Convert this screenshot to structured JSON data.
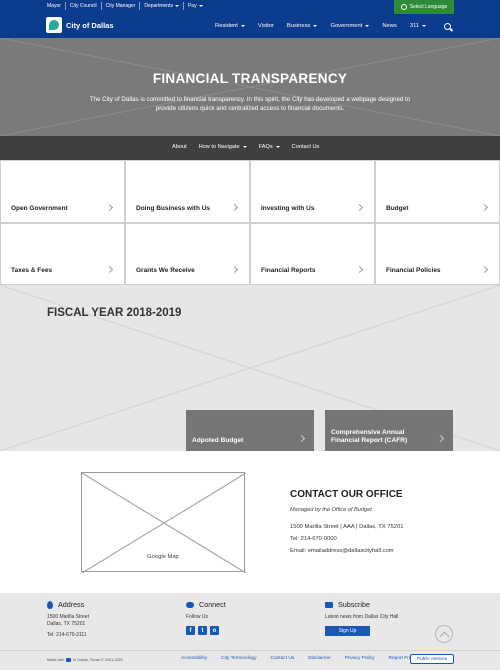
{
  "utility": {
    "links": [
      "Mayor",
      "City Council",
      "City Manager",
      "Departments",
      "Pay"
    ],
    "language_button": "Select Language"
  },
  "header": {
    "logo_text": "City of Dallas",
    "nav": [
      "Resident",
      "Visitor",
      "Business",
      "Government",
      "News",
      "311"
    ]
  },
  "hero": {
    "title": "FINANCIAL TRANSPARENCY",
    "description": "The City of Dallas is committed to financial transparency. In this spirit, the City has developed a webpage designed to provide citizens quick and centralized access to financial documents."
  },
  "subnav": {
    "items": [
      "About",
      "How to Navigate",
      "FAQs",
      "Contact Us"
    ]
  },
  "tiles": [
    "Open Government",
    "Doing Business with Us",
    "Investing with Us",
    "Budget",
    "Taxes & Fees",
    "Grants We Receive",
    "Financial Reports",
    "Financial Policies"
  ],
  "fiscal": {
    "title": "FISCAL YEAR 2018-2019",
    "buttons": [
      {
        "line1": "Adpoted Budget",
        "line2": ""
      },
      {
        "line1": "Comprehensive Annual",
        "line2": "Financial Report (CAFR)"
      }
    ]
  },
  "contact": {
    "map_label": "Google Map",
    "title": "CONTACT OUR OFFICE",
    "managed_by": "Managed by the Office of Budget",
    "address": "1500 Marilla Street | AAA | Dallas, TX 75201",
    "tel": "Tel:  214-670-0000",
    "email": "Email: emailaddress@dallascityhall.com"
  },
  "footer": {
    "address": {
      "heading": "Address",
      "line1": "1500 Marilla Street",
      "line2": "Dallas, TX 75201",
      "tel": "Tel: 214-670-3111"
    },
    "connect": {
      "heading": "Connect",
      "follow": "Follow Us",
      "social": [
        "f",
        "t",
        "o"
      ]
    },
    "subscribe": {
      "heading": "Subscribe",
      "text": "Latest news from Dallas City Hall",
      "button": "Sign Up"
    },
    "made_with_prefix": "Made with",
    "made_with_suffix": "in Dallas, Texas © 2001-2021",
    "links": [
      "Accessibility",
      "City Terminology",
      "Contact Us",
      "Disclaimer",
      "Privacy Policy",
      "Report Fraud"
    ],
    "public_notices": "Public Notices"
  },
  "colors": {
    "brand_blue": "#0b3b8c",
    "language_green": "#2e8a3b",
    "link_blue": "#1a58b5"
  }
}
